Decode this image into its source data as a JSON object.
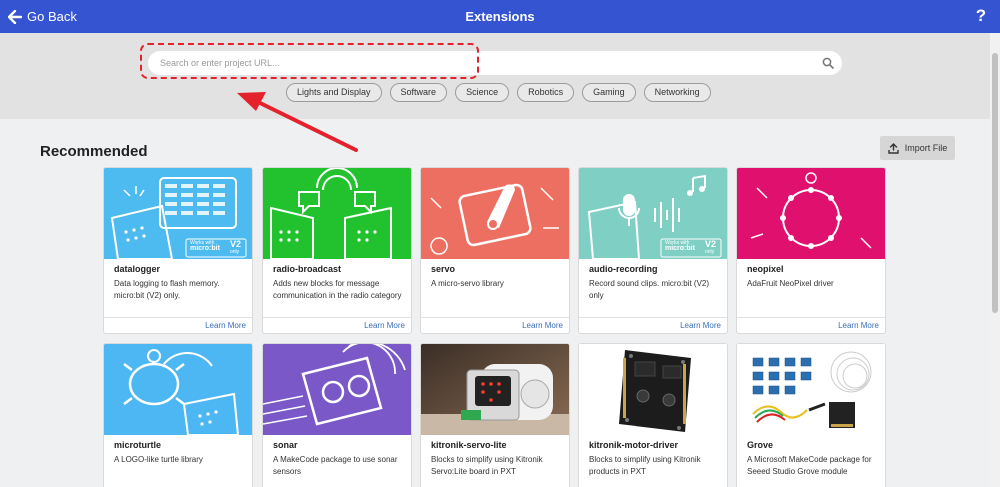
{
  "header": {
    "back_label": "Go Back",
    "title": "Extensions",
    "help_label": "?"
  },
  "search": {
    "placeholder": "Search or enter project URL..."
  },
  "categories": [
    "Lights and Display",
    "Software",
    "Science",
    "Robotics",
    "Gaming",
    "Networking"
  ],
  "section": {
    "title": "Recommended",
    "import_label": "Import File"
  },
  "learn_more": "Learn More",
  "badge": {
    "line1": "Works with",
    "line2": "micro:bit",
    "v2": "V2",
    "only": "only"
  },
  "cards": [
    {
      "name": "datalogger",
      "desc": "Data logging to flash memory. micro:bit (V2) only.",
      "color": "#4dbbf0"
    },
    {
      "name": "radio-broadcast",
      "desc": "Adds new blocks for message communication in the radio category",
      "color": "#22c22e"
    },
    {
      "name": "servo",
      "desc": "A micro-servo library",
      "color": "#ec6f62"
    },
    {
      "name": "audio-recording",
      "desc": "Record sound clips. micro:bit (V2) only",
      "color": "#7fcfc5"
    },
    {
      "name": "neopixel",
      "desc": "AdaFruit NeoPixel driver",
      "color": "#e0106f"
    },
    {
      "name": "microturtle",
      "desc": "A LOGO-like turtle library",
      "color": "#4cb7f2"
    },
    {
      "name": "sonar",
      "desc": "A MakeCode package to use sonar sensors",
      "color": "#7a58c8"
    },
    {
      "name": "kitronik-servo-lite",
      "desc": "Blocks to simplify using Kitronik Servo:Lite board in PXT",
      "color": "#5b4a3e"
    },
    {
      "name": "kitronik-motor-driver",
      "desc": "Blocks to simplify using Kitronik products in PXT",
      "color": "#ffffff"
    },
    {
      "name": "Grove",
      "desc": "A Microsoft MakeCode package for Seeed Studio Grove module",
      "color": "#ffffff"
    }
  ]
}
